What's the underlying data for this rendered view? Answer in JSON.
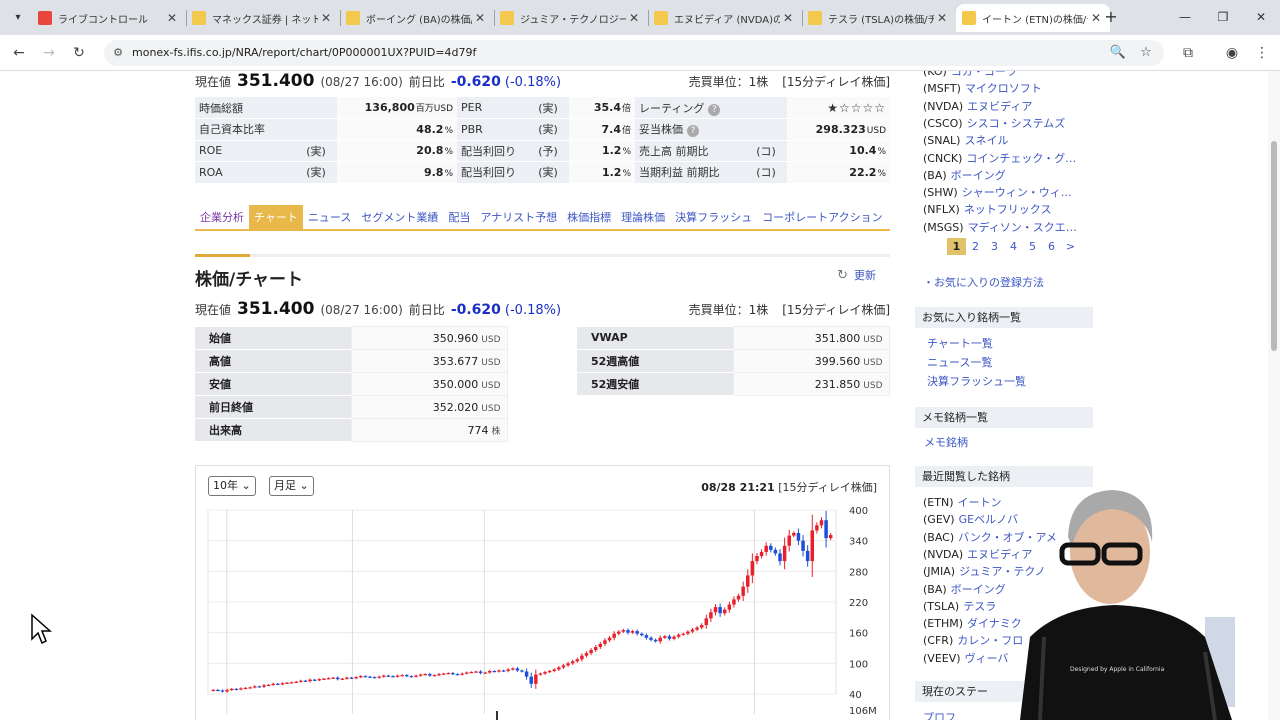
{
  "browser": {
    "tabs": [
      {
        "title": "ライブコントロール",
        "icon": "youtube-studio-icon",
        "color": "#e8453c"
      },
      {
        "title": "マネックス証券 | ネット証",
        "icon": "monex-icon",
        "color": "#f2c94c"
      },
      {
        "title": "ボーイング (BA)の株価/",
        "icon": "monex-icon",
        "color": "#f2c94c"
      },
      {
        "title": "ジュミア・テクノロジーズ (",
        "icon": "monex-icon",
        "color": "#f2c94c"
      },
      {
        "title": "エヌビディア (NVDA)の株",
        "icon": "monex-icon",
        "color": "#f2c94c"
      },
      {
        "title": "テスラ (TSLA)の株価/チ",
        "icon": "monex-icon",
        "color": "#f2c94c"
      },
      {
        "title": "イートン (ETN)の株価/チ",
        "icon": "monex-icon",
        "color": "#f2c94c"
      }
    ],
    "url": "monex-fs.ifis.co.jp/NRA/report/chart/0P000001UX?PUID=4d79f"
  },
  "quote_top": {
    "price_label": "現在値",
    "price": "351.400",
    "datetime": "(08/27 16:00)",
    "change_label": "前日比",
    "change": "-0.620",
    "change_pct": "(-0.18%)",
    "unit_label": "売買単位：1株",
    "delay": "[15分ディレイ株価]"
  },
  "metrics": {
    "r1": {
      "k1": "時価総額",
      "v1": "136,800",
      "u1": "百万USD",
      "k2": "PER",
      "q2": "(実)",
      "v2": "35.4",
      "u2": "倍",
      "k3": "レーティング",
      "v3": "★☆☆☆☆"
    },
    "r2": {
      "k1": "自己資本比率",
      "v1": "48.2",
      "u1": "%",
      "k2": "PBR",
      "q2": "(実)",
      "v2": "7.4",
      "u2": "倍",
      "k3": "妥当株価",
      "v3": "298.323",
      "u3": "USD"
    },
    "r3": {
      "k1": "ROE",
      "q1": "(実)",
      "v1": "20.8",
      "u1": "%",
      "k2": "配当利回り",
      "q2": "(予)",
      "v2": "1.2",
      "u2": "%",
      "k3": "売上高 前期比",
      "q3": "(コ)",
      "v3": "10.4",
      "u3": "%"
    },
    "r4": {
      "k1": "ROA",
      "q1": "(実)",
      "v1": "9.8",
      "u1": "%",
      "k2": "配当利回り",
      "q2": "(実)",
      "v2": "1.2",
      "u2": "%",
      "k3": "当期利益 前期比",
      "q3": "(コ)",
      "v3": "22.2",
      "u3": "%"
    }
  },
  "subnav": [
    "企業分析",
    "チャート",
    "ニュース",
    "セグメント業績",
    "配当",
    "アナリスト予想",
    "株価指標",
    "理論株価",
    "決算フラッシュ",
    "コーポレートアクション"
  ],
  "section": {
    "title": "株価/チャート",
    "refresh": "更新"
  },
  "quote_mid": {
    "price_label": "現在値",
    "price": "351.400",
    "datetime": "(08/27 16:00)",
    "change_label": "前日比",
    "change": "-0.620",
    "change_pct": "(-0.18%)",
    "unit_label": "売買単位：1株",
    "delay": "[15分ディレイ株価]"
  },
  "ohlc_left": [
    {
      "label": "始値",
      "value": "350.960",
      "unit": "USD"
    },
    {
      "label": "高値",
      "value": "353.677",
      "unit": "USD"
    },
    {
      "label": "安値",
      "value": "350.000",
      "unit": "USD"
    },
    {
      "label": "前日終値",
      "value": "352.020",
      "unit": "USD"
    },
    {
      "label": "出来高",
      "value": "774",
      "unit": "株"
    }
  ],
  "ohlc_right": [
    {
      "label": "VWAP",
      "value": "351.800",
      "unit": "USD"
    },
    {
      "label": "52週高値",
      "value": "399.560",
      "unit": "USD"
    },
    {
      "label": "52週安値",
      "value": "231.850",
      "unit": "USD"
    }
  ],
  "chart": {
    "period": "10年",
    "interval": "月足",
    "timestamp": "08/28 21:21",
    "delay": "[15分ディレイ株価]",
    "volume_label": "106M"
  },
  "chart_data": {
    "type": "candlestick",
    "yticks": [
      400,
      340,
      280,
      220,
      160,
      100,
      40
    ],
    "ylim": [
      40,
      400
    ],
    "up_color": "#e8202a",
    "down_color": "#1f4fd8",
    "closes": [
      48,
      47,
      45,
      48,
      50,
      49,
      51,
      52,
      53,
      55,
      54,
      57,
      58,
      60,
      59,
      61,
      62,
      63,
      64,
      66,
      65,
      68,
      67,
      69,
      70,
      71,
      72,
      69,
      70,
      72,
      71,
      73,
      75,
      74,
      73,
      72,
      74,
      76,
      75,
      74,
      76,
      77,
      75,
      74,
      76,
      78,
      79,
      76,
      77,
      79,
      80,
      81,
      79,
      78,
      80,
      82,
      83,
      84,
      81,
      82,
      85,
      84,
      86,
      85,
      88,
      90,
      86,
      84,
      74,
      60,
      78,
      80,
      83,
      85,
      88,
      92,
      96,
      100,
      104,
      108,
      115,
      120,
      126,
      132,
      138,
      145,
      150,
      158,
      162,
      165,
      160,
      163,
      158,
      155,
      150,
      146,
      143,
      150,
      153,
      148,
      152,
      156,
      158,
      162,
      166,
      170,
      175,
      188,
      200,
      210,
      198,
      205,
      215,
      225,
      232,
      250,
      272,
      300,
      310,
      318,
      330,
      322,
      315,
      300,
      330,
      350,
      355,
      340,
      320,
      300,
      360,
      370,
      380,
      345,
      351
    ]
  },
  "sidebar": {
    "top_list": [
      {
        "ticker": "(KO)",
        "name": "コカ・コーラ"
      },
      {
        "ticker": "(MSFT)",
        "name": "マイクロソフト"
      },
      {
        "ticker": "(NVDA)",
        "name": "エヌビディア"
      },
      {
        "ticker": "(CSCO)",
        "name": "シスコ・システムズ"
      },
      {
        "ticker": "(SNAL)",
        "name": "スネイル"
      },
      {
        "ticker": "(CNCK)",
        "name": "コインチェック・グ…"
      },
      {
        "ticker": "(BA)",
        "name": "ボーイング"
      },
      {
        "ticker": "(SHW)",
        "name": "シャーウィン・ウィ…"
      },
      {
        "ticker": "(NFLX)",
        "name": "ネットフリックス"
      },
      {
        "ticker": "(MSGS)",
        "name": "マディソン・スクエ…"
      }
    ],
    "pages": [
      "1",
      "2",
      "3",
      "4",
      "5",
      "6",
      ">"
    ],
    "fav_howto": "・お気に入りの登録方法",
    "fav_header": "お気に入り銘柄一覧",
    "fav_links": [
      "チャート一覧",
      "ニュース一覧",
      "決算フラッシュ一覧"
    ],
    "memo_header": "メモ銘柄一覧",
    "memo_link": "メモ銘柄",
    "recent_header": "最近閲覧した銘柄",
    "recent_list": [
      {
        "ticker": "(ETN)",
        "name": "イートン"
      },
      {
        "ticker": "(GEV)",
        "name": "GEベルノバ"
      },
      {
        "ticker": "(BAC)",
        "name": "バンク・オブ・アメ"
      },
      {
        "ticker": "(NVDA)",
        "name": "エヌビディア"
      },
      {
        "ticker": "(JMIA)",
        "name": "ジュミア・テクノ"
      },
      {
        "ticker": "(BA)",
        "name": "ボーイング"
      },
      {
        "ticker": "(TSLA)",
        "name": "テスラ"
      },
      {
        "ticker": "(ETHM)",
        "name": "ダイナミク"
      },
      {
        "ticker": "(CFR)",
        "name": "カレン・フロ"
      },
      {
        "ticker": "(VEEV)",
        "name": "ヴィーバ"
      }
    ],
    "status_header": "現在のステー",
    "profile_link": "プロフ"
  },
  "webcam_shirt_text": "Designed by Apple in California"
}
